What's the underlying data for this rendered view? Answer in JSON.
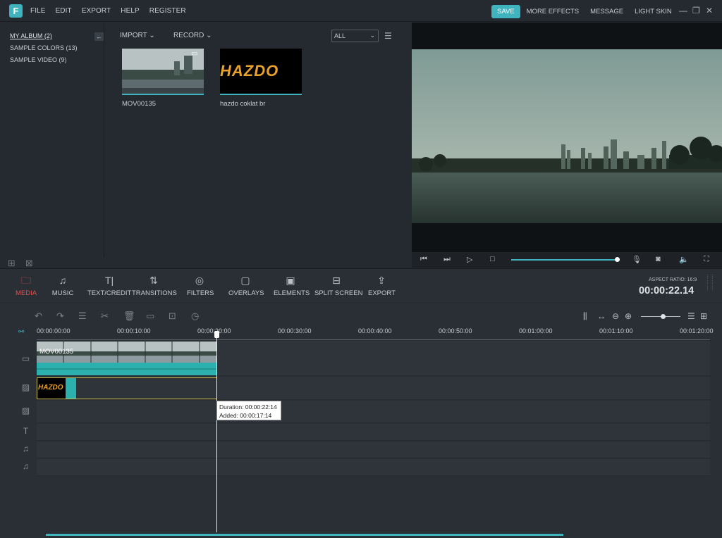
{
  "app": {
    "logo_letter": "F",
    "menu": [
      "FILE",
      "EDIT",
      "EXPORT",
      "HELP",
      "REGISTER"
    ],
    "save_label": "SAVE",
    "top_actions": [
      "MORE EFFECTS",
      "MESSAGE",
      "LIGHT SKIN"
    ],
    "accent_color": "#3fb3be"
  },
  "library": {
    "items": [
      {
        "label": "MY ALBUM (2)",
        "active": true
      },
      {
        "label": "SAMPLE COLORS (13)",
        "active": false
      },
      {
        "label": "SAMPLE VIDEO (9)",
        "active": false
      }
    ]
  },
  "media": {
    "import_label": "IMPORT",
    "record_label": "RECORD",
    "filter_value": "ALL",
    "items": [
      {
        "label": "MOV00135",
        "kind": "video"
      },
      {
        "label": "hazdo coklat br",
        "kind": "image",
        "logo_text": "HAZDO"
      }
    ]
  },
  "preview": {
    "progress": 1.0
  },
  "toolbar": {
    "tools": [
      {
        "label": "MEDIA",
        "icon": "folder-icon",
        "active": true
      },
      {
        "label": "MUSIC",
        "icon": "music-icon",
        "active": false
      },
      {
        "label": "TEXT/CREDIT",
        "icon": "text-icon",
        "active": false
      },
      {
        "label": "TRANSITIONS",
        "icon": "transition-icon",
        "active": false
      },
      {
        "label": "FILTERS",
        "icon": "filter-icon",
        "active": false
      },
      {
        "label": "OVERLAYS",
        "icon": "overlay-icon",
        "active": false
      },
      {
        "label": "ELEMENTS",
        "icon": "elements-icon",
        "active": false
      },
      {
        "label": "SPLIT SCREEN",
        "icon": "split-screen-icon",
        "active": false
      },
      {
        "label": "EXPORT",
        "icon": "export-icon",
        "active": false
      }
    ],
    "aspect_ratio": "ASPECT RATIO: 16:9",
    "timecode": "00:00:22.14"
  },
  "timeline": {
    "ticks": [
      "00:00:00:00",
      "00:00:10:00",
      "00:00:20:00",
      "00:00:30:00",
      "00:00:40:00",
      "00:00:50:00",
      "00:01:00:00",
      "00:01:10:00",
      "00:01:20:00"
    ],
    "video_clip_label": "MOV00135",
    "image_clip_label": "HAZDO",
    "tooltip_duration": "Duration: 00:00:22:14",
    "tooltip_added": "Added: 00:00:17:14",
    "zoom_level": 0.55
  }
}
